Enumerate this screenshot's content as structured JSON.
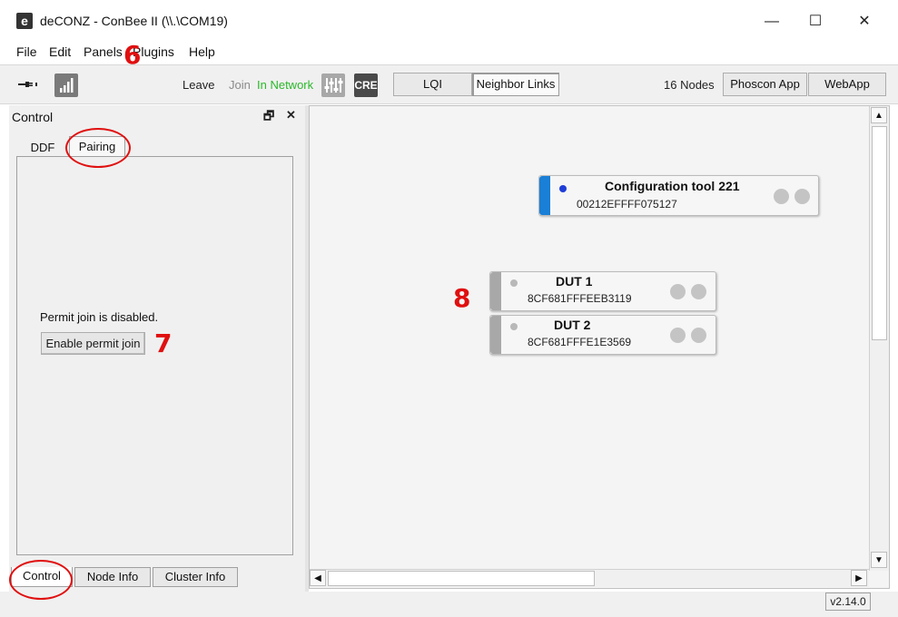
{
  "window": {
    "title": "deCONZ - ConBee II (\\\\.\\COM19)",
    "icon_letter": "e",
    "minimize": "—",
    "maximize": "☐",
    "close": "✕"
  },
  "menu": {
    "file": "File",
    "edit": "Edit",
    "panels": "Panels",
    "plugins": "Plugins",
    "help": "Help"
  },
  "toolbar": {
    "leave": "Leave",
    "join": "Join",
    "status": "In Network",
    "cre_label": "CRE",
    "lqi": "LQI",
    "neighbor_links": "Neighbor Links",
    "node_count": "16 Nodes",
    "phoscon_app": "Phoscon App",
    "webapp": "WebApp",
    "status_color": "#2bb82b"
  },
  "control_panel": {
    "title": "Control",
    "float_icon": "🗗",
    "close_icon": "✕",
    "tabs": [
      {
        "label": "DDF"
      },
      {
        "label": "Pairing"
      }
    ],
    "permit_status": "Permit join is disabled.",
    "enable_button": "Enable permit join",
    "bottom_tabs": [
      {
        "label": "Control"
      },
      {
        "label": "Node Info"
      },
      {
        "label": "Cluster Info"
      }
    ]
  },
  "nodes": [
    {
      "name": "Configuration tool 221",
      "address": "00212EFFFF075127",
      "stripe_color": "#1a7fd6",
      "dot_color": "#1f3ed8"
    },
    {
      "name": "DUT 1",
      "address": "8CF681FFFEEB3119",
      "stripe_color": "#a8a8a8",
      "dot_color": "#b8b8b8"
    },
    {
      "name": "DUT 2",
      "address": "8CF681FFFE1E3569",
      "stripe_color": "#a8a8a8",
      "dot_color": "#b8b8b8"
    }
  ],
  "status_bar": {
    "version": "v2.14.0"
  },
  "annotations": {
    "step6": "6",
    "step7": "7",
    "step8": "8",
    "color": "#e01010"
  }
}
